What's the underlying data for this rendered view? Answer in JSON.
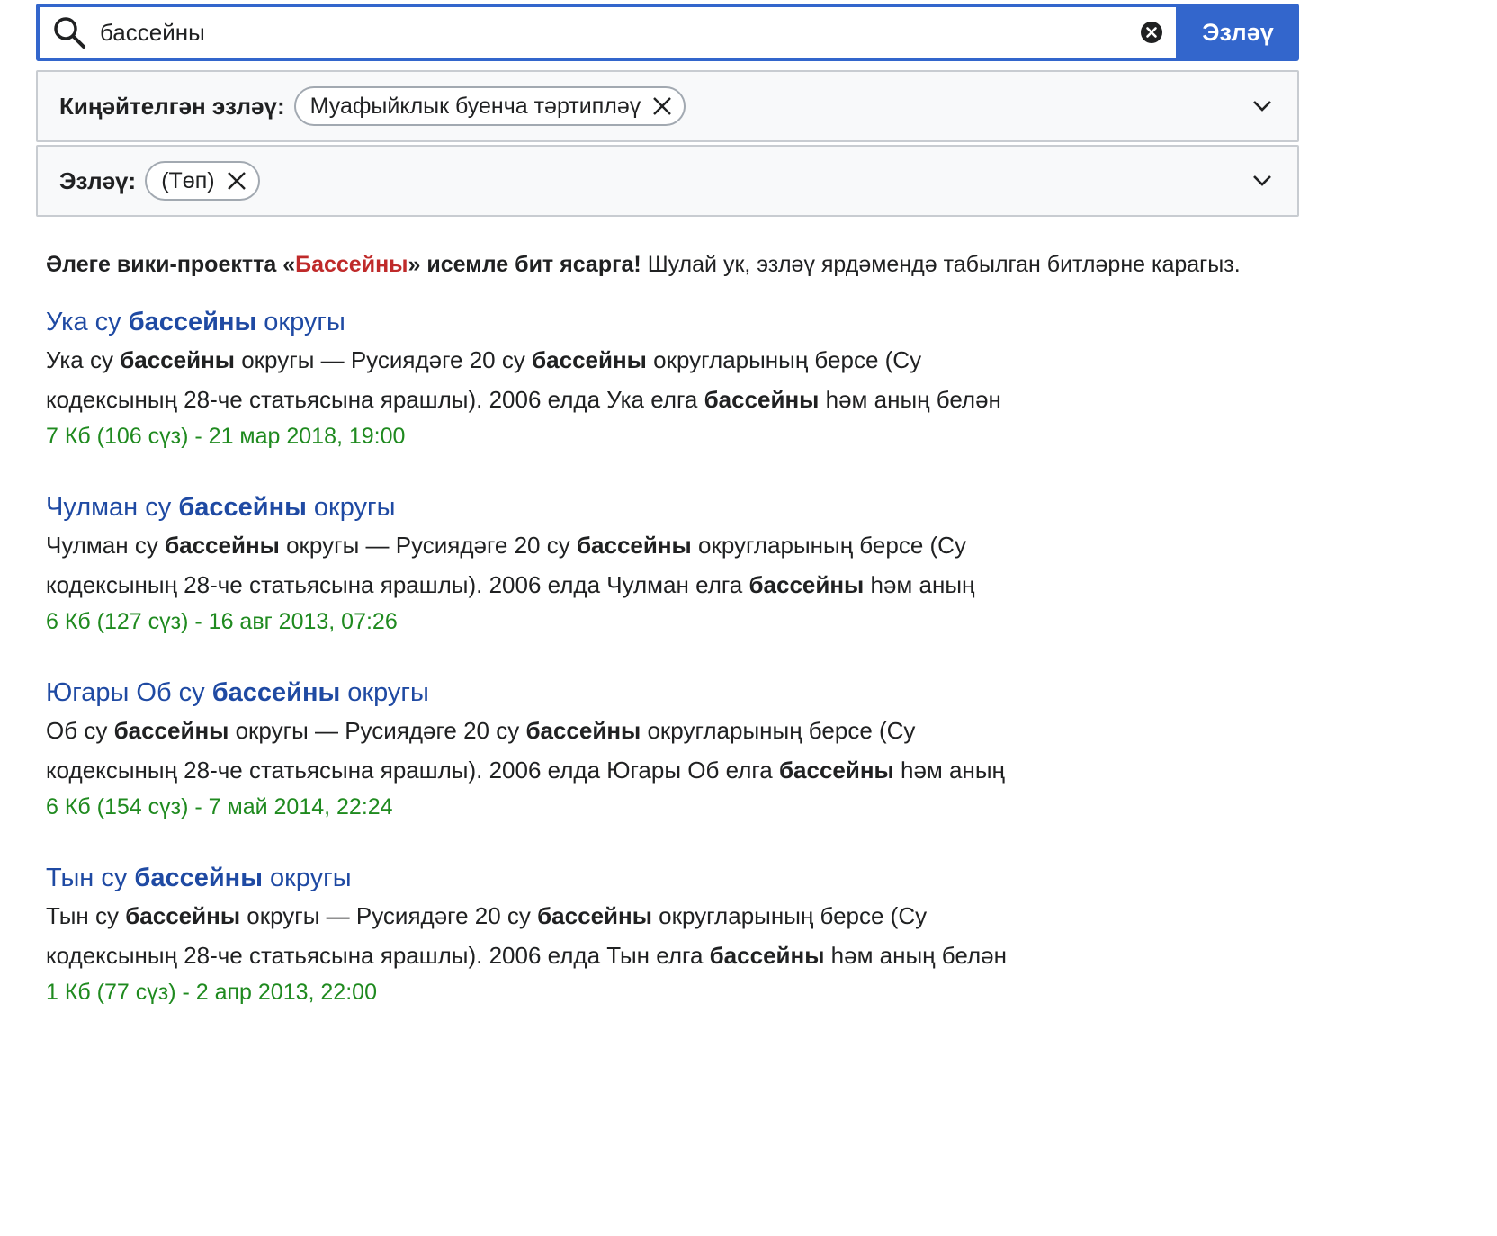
{
  "search": {
    "value": "бассейны",
    "button_label": "Эзләү"
  },
  "advanced": {
    "label": "Киңәйтелгән эзләү:",
    "chip": "Муафыйклык буенча тәртипләү"
  },
  "namespace": {
    "label": "Эзләү:",
    "chip": "(Төп)"
  },
  "notice": {
    "prefix": "Әлеге вики-проектта «",
    "link": "Бассейны",
    "middle": "» исемле бит ясарга!",
    "suffix": " Шулай ук, эзләү ярдәмендә табылган битләрне карагыз."
  },
  "results": [
    {
      "title": [
        "Ука су ",
        "бассейны",
        " округы"
      ],
      "snippet": [
        "Ука су ",
        "бассейны",
        " округы — Русиядәге 20 су ",
        "бассейны",
        " округларының берсе (Су кодексының 28-че статьясына ярашлы). 2006 елда Ука елга ",
        "бассейны",
        " һәм аның белән"
      ],
      "meta": "7 Кб (106 сүз) - 21 мар 2018, 19:00"
    },
    {
      "title": [
        "Чулман су ",
        "бассейны",
        " округы"
      ],
      "snippet": [
        "Чулман су ",
        "бассейны",
        " округы — Русиядәге 20 су ",
        "бассейны",
        " округларының берсе (Су кодексының 28-че статьясына ярашлы). 2006 елда Чулман елга ",
        "бассейны",
        " һәм аның"
      ],
      "meta": "6 Кб (127 сүз) - 16 авг 2013, 07:26"
    },
    {
      "title": [
        "Югары Об су ",
        "бассейны",
        " округы"
      ],
      "snippet": [
        "Об су ",
        "бассейны",
        " округы — Русиядәге 20 су ",
        "бассейны",
        " округларының берсе (Су кодексының 28-че статьясына ярашлы). 2006 елда Югары Об елга ",
        "бассейны",
        " һәм аның"
      ],
      "meta": "6 Кб (154 сүз) - 7 май 2014, 22:24"
    },
    {
      "title": [
        "Тын су ",
        "бассейны",
        " округы"
      ],
      "snippet": [
        "Тын су ",
        "бассейны",
        " округы — Русиядәге 20 су ",
        "бассейны",
        " округларының берсе (Су кодексының 28-че статьясына ярашлы). 2006 елда Тын елга ",
        "бассейны",
        " һәм аның белән"
      ],
      "meta": "1 Кб (77 сүз) - 2 апр 2013, 22:00"
    }
  ],
  "colors": {
    "accent": "#3366cc",
    "link": "#1f4aa3",
    "redlink": "#bf2a2a",
    "meta": "#1f8a1f"
  }
}
